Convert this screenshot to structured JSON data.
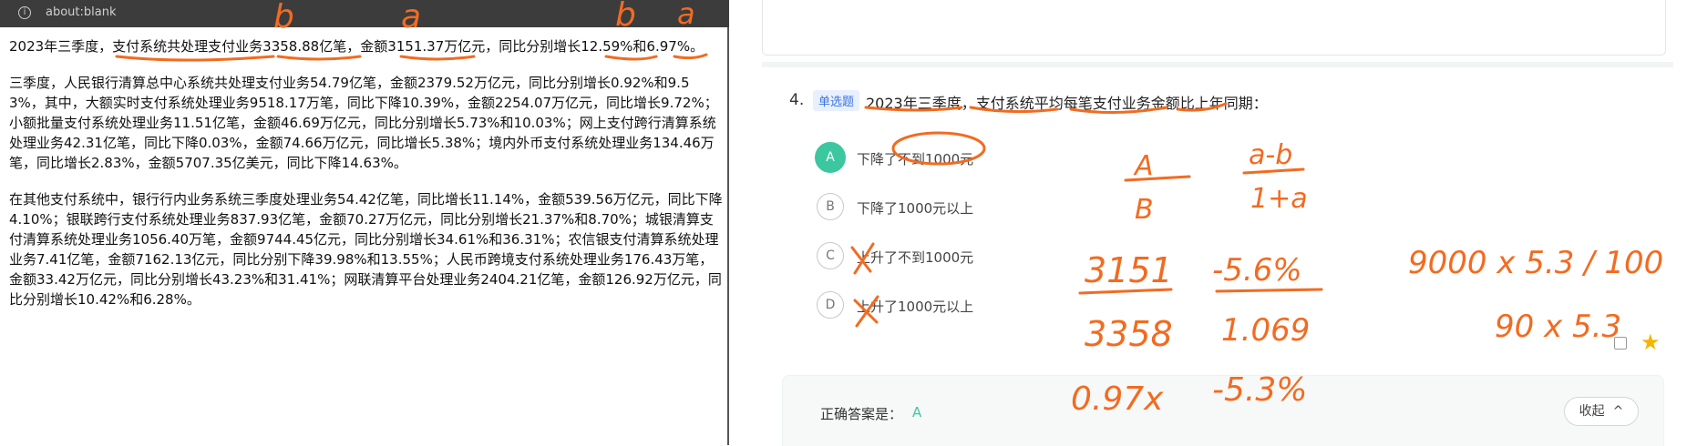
{
  "browser": {
    "url": "about:blank"
  },
  "document": {
    "paragraphs": [
      "2023年三季度，支付系统共处理支付业务3358.88亿笔，金额3151.37万亿元，同比分别增长12.59%和6.97%。",
      "三季度，人民银行清算总中心系统共处理支付业务54.79亿笔，金额2379.52万亿元，同比分别增长0.92%和9.53%，其中，大额实时支付系统处理业务9518.17万笔，同比下降10.39%，金额2254.07万亿元，同比增长9.72%；小额批量支付系统处理业务11.51亿笔，金额46.69万亿元，同比分别增长5.73%和10.03%；网上支付跨行清算系统处理业务42.31亿笔，同比下降0.03%，金额74.66万亿元，同比增长5.38%；境内外币支付系统处理业务134.46万笔，同比增长2.83%，金额5707.35亿美元，同比下降14.63%。",
      "在其他支付系统中，银行行内业务系统三季度处理业务54.42亿笔，同比增长11.14%，金额539.56万亿元，同比下降4.10%；银联跨行支付系统处理业务837.93亿笔，金额70.27万亿元，同比分别增长21.37%和8.70%；城银清算支付清算系统处理业务1056.40万笔，金额9744.45亿元，同比分别增长34.61%和36.31%；农信银支付清算系统处理业务7.41亿笔，金额7162.13亿元，同比分别下降39.98%和13.55%；人民币跨境支付系统处理业务176.43万笔，金额33.42万亿元，同比分别增长43.23%和31.41%；网联清算平台处理业务2404.21亿笔，金额126.92万亿元，同比分别增长10.42%和6.28%。"
    ]
  },
  "question": {
    "number": "4.",
    "type_tag": "单选题",
    "text": "2023年三季度，支付系统平均每笔支付业务金额比上年同期：",
    "options": [
      {
        "letter": "A",
        "text": "下降了不到1000元",
        "selected": true
      },
      {
        "letter": "B",
        "text": "下降了1000元以上",
        "selected": false
      },
      {
        "letter": "C",
        "text": "上升了不到1000元",
        "selected": false
      },
      {
        "letter": "D",
        "text": "上升了1000元以上",
        "selected": false
      }
    ],
    "answer_label": "正确答案是：",
    "answer_value": "A",
    "collapse_label": "收起",
    "collapse_icon": "chevron-up-icon"
  },
  "handwriting": {
    "over_text": [
      "b",
      "a",
      "b",
      "a"
    ],
    "formula_1_num": "A",
    "formula_1_den": "B",
    "formula_2_num": "a-b",
    "formula_2_den": "1+a",
    "calc_1_num": "3151",
    "calc_1_den": "3358",
    "calc_2_num": "-5.6%",
    "calc_2_den": "1.069",
    "result_1": "0.97x",
    "result_2": "-5.3%",
    "side_calc_1": "9000 x 5.3 / 100",
    "side_calc_2": "90 x 5.3"
  },
  "colors": {
    "ink": "#f26b21",
    "accent": "#3cc7a0",
    "tag": "#3b74e0",
    "star": "#f5b400"
  }
}
